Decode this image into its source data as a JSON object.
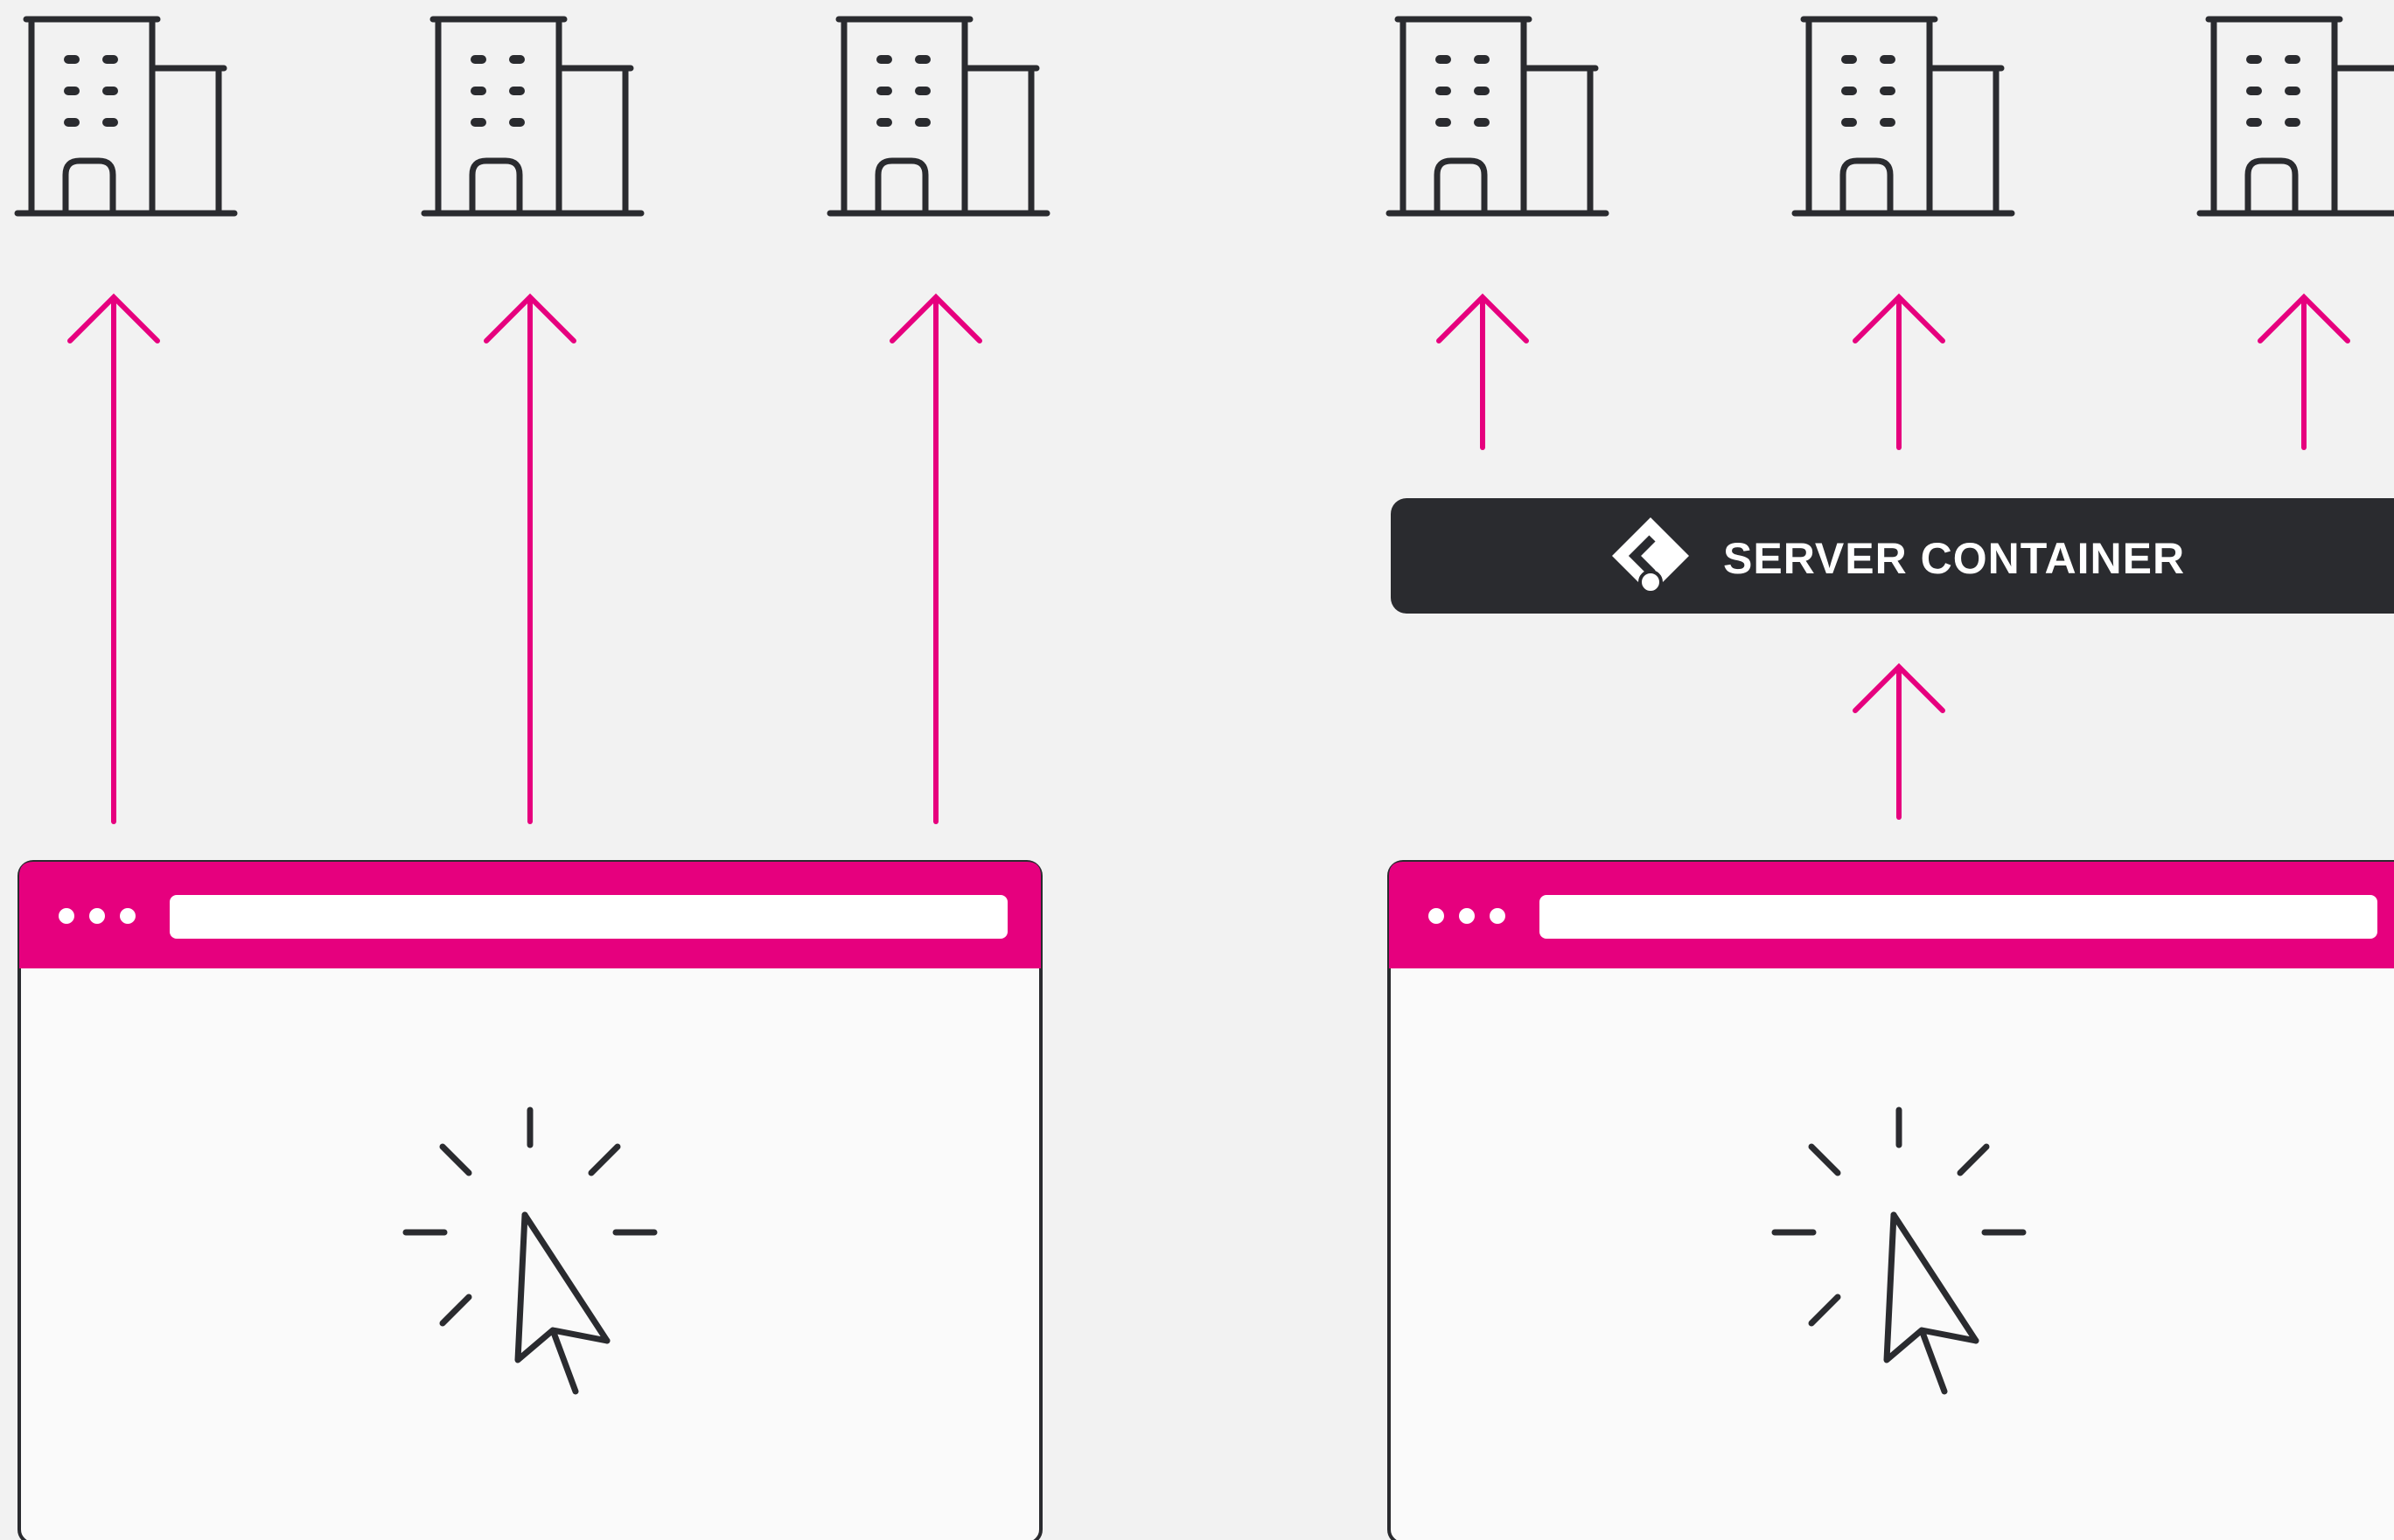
{
  "server_container": {
    "label": "SERVER CONTAINER",
    "icon": "tag-manager-icon"
  },
  "left_side": {
    "destinations": [
      {
        "icon": "building-icon"
      },
      {
        "icon": "building-icon"
      },
      {
        "icon": "building-icon"
      }
    ],
    "browser": {
      "icons": [
        "window-dots-icon",
        "hamburger-menu-icon",
        "cursor-click-icon"
      ]
    }
  },
  "right_side": {
    "destinations": [
      {
        "icon": "building-icon"
      },
      {
        "icon": "building-icon"
      },
      {
        "icon": "building-icon"
      }
    ],
    "browser": {
      "icons": [
        "window-dots-icon",
        "hamburger-menu-icon",
        "cursor-click-icon"
      ]
    }
  },
  "colors": {
    "background": "#f2f2f2",
    "arrow": "#e6007e",
    "browser_bar": "#e6007e",
    "icon_stroke": "#2a2b2f",
    "server_bg": "#2a2b2f",
    "browser_body": "#fafafa"
  }
}
